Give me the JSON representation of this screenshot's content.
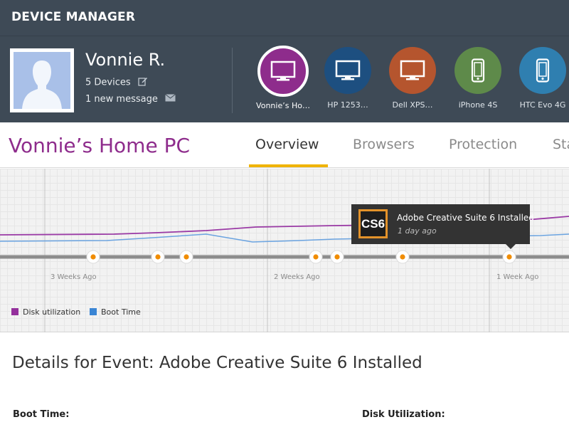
{
  "header": {
    "app_title": "DEVICE MANAGER"
  },
  "user": {
    "name": "Vonnie R.",
    "devices": "5 Devices",
    "messages": "1 new message",
    "edit_icon": "edit-icon",
    "mail_icon": "mail-icon"
  },
  "devices": [
    {
      "label": "Vonnie’s Ho…",
      "color": "#8e2c8c",
      "icon": "monitor-icon",
      "selected": true
    },
    {
      "label": "HP 1253…",
      "color": "#1d4f80",
      "icon": "monitor-icon",
      "selected": false
    },
    {
      "label": "Dell XPS…",
      "color": "#b5552e",
      "icon": "monitor-icon",
      "selected": false
    },
    {
      "label": "iPhone 4S",
      "color": "#5e8a4a",
      "icon": "phone-icon",
      "selected": false
    },
    {
      "label": "HTC Evo 4G",
      "color": "#2f7fb0",
      "icon": "phone-icon",
      "selected": false
    }
  ],
  "tabs": {
    "device_title": "Vonnie’s Home PC",
    "items": [
      "Overview",
      "Browsers",
      "Protection",
      "Sta"
    ],
    "active": "Overview",
    "accent": "#f0b400"
  },
  "timeline": {
    "week_labels": [
      "3 Weeks Ago",
      "2 Weeks Ago",
      "1 Week Ago"
    ],
    "tooltip": {
      "logo_text": "CS6",
      "title": "Adobe Creative Suite 6 Installed",
      "subtitle": "1 day ago"
    },
    "legend": [
      {
        "label": "Disk utilization",
        "color": "#94309c"
      },
      {
        "label": "Boot Time",
        "color": "#3a85d4"
      }
    ],
    "event_marker_color": "#f08c00"
  },
  "details": {
    "title": "Details for Event: Adobe Creative Suite 6 Installed",
    "boot_time_label": "Boot Time:",
    "disk_util_label": "Disk Utilization:"
  }
}
